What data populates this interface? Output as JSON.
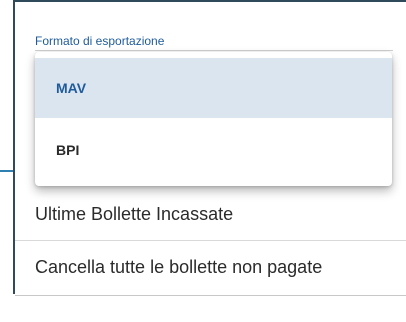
{
  "export_field": {
    "label": "Formato di esportazione",
    "options": [
      {
        "label": "MAV",
        "selected": true
      },
      {
        "label": "BPI",
        "selected": false
      }
    ]
  },
  "menu": {
    "items": [
      {
        "label": "Ultime Bollette Incassate"
      },
      {
        "label": "Cancella tutte le bollette non pagate"
      }
    ]
  },
  "colors": {
    "accent": "#1f5b9a",
    "selected_bg": "#dbe5f0",
    "arrow": "#2f7fb0",
    "frame_border": "#2f4a5a"
  }
}
